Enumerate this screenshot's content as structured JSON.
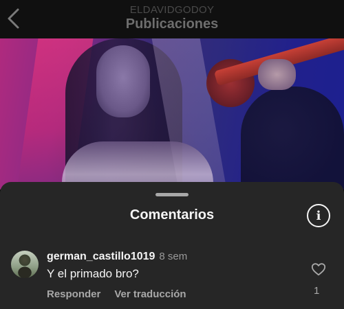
{
  "header": {
    "account": "ELDAVIDGODOY",
    "title": "Publicaciones",
    "back_icon": "chevron-left-icon"
  },
  "post": {
    "image_subject": "post-photo"
  },
  "comments_sheet": {
    "title": "Comentarios",
    "info_icon": "info-icon",
    "info_glyph": "i",
    "comments": [
      {
        "username": "german_castillo1019",
        "time": "8 sem",
        "text": "Y el primado bro?",
        "reply_label": "Responder",
        "translate_label": "Ver traducción",
        "likes": "1"
      }
    ]
  },
  "colors": {
    "sheet_bg": "#262626",
    "header_bg": "#101010",
    "text_primary": "#f5f5f5",
    "text_secondary": "#a8a8a8"
  }
}
